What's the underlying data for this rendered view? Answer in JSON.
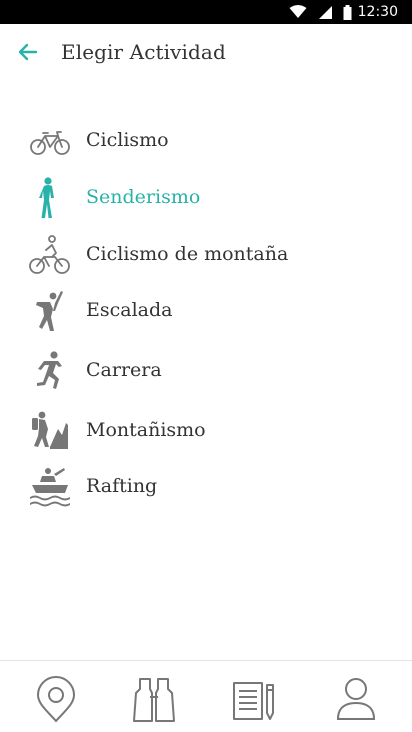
{
  "status_bar": {
    "time": "12:30",
    "icons": [
      "wifi-icon",
      "signal-icon",
      "battery-icon"
    ]
  },
  "app_bar": {
    "title": "Elegir Actividad",
    "back_icon": "back-arrow-icon",
    "accent": "#29b2a9"
  },
  "activities": [
    {
      "label": "Ciclismo",
      "icon": "bicycle-icon",
      "selected": false
    },
    {
      "label": "Senderismo",
      "icon": "hiking-icon",
      "selected": true
    },
    {
      "label": "Ciclismo de montaña",
      "icon": "mountain-bike-icon",
      "selected": false
    },
    {
      "label": "Escalada",
      "icon": "climbing-icon",
      "selected": false
    },
    {
      "label": "Carrera",
      "icon": "running-icon",
      "selected": false
    },
    {
      "label": "Montañismo",
      "icon": "mountaineering-icon",
      "selected": false
    },
    {
      "label": "Rafting",
      "icon": "rafting-icon",
      "selected": false
    }
  ],
  "bottom_nav": [
    {
      "icon": "map-pin-icon"
    },
    {
      "icon": "binoculars-icon"
    },
    {
      "icon": "notes-icon"
    },
    {
      "icon": "profile-icon"
    }
  ]
}
